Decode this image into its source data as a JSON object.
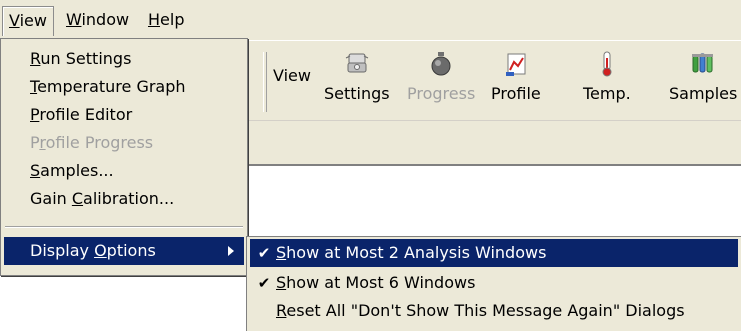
{
  "menubar": {
    "view": "View",
    "window": "Window",
    "help": "Help"
  },
  "view_menu": {
    "items": [
      {
        "label": "Run Settings",
        "enabled": true
      },
      {
        "label": "Temperature Graph",
        "enabled": true
      },
      {
        "label": "Profile Editor",
        "enabled": true
      },
      {
        "label": "Profile Progress",
        "enabled": false
      },
      {
        "label": "Samples...",
        "enabled": true
      },
      {
        "label": "Gain Calibration...",
        "enabled": true
      }
    ],
    "display_options": "Display Options"
  },
  "display_options_menu": {
    "items": [
      {
        "label": "Show at Most 2 Analysis Windows",
        "checked": true,
        "highlighted": true
      },
      {
        "label": "Show at Most 6 Windows",
        "checked": true,
        "highlighted": false
      },
      {
        "label": "Reset All \"Don't Show This Message Again\" Dialogs",
        "checked": false,
        "highlighted": false
      }
    ],
    "check_glyph": "✔"
  },
  "toolbar": {
    "caption": "View",
    "buttons": [
      {
        "label": "Settings",
        "icon": "settings-icon",
        "enabled": true
      },
      {
        "label": "Progress",
        "icon": "progress-icon",
        "enabled": false
      },
      {
        "label": "Profile",
        "icon": "profile-icon",
        "enabled": true
      },
      {
        "label": "Temp.",
        "icon": "thermometer-icon",
        "enabled": true
      },
      {
        "label": "Samples",
        "icon": "samples-icon",
        "enabled": true
      }
    ]
  },
  "colors": {
    "menu_face": "#ece9d8",
    "highlight": "#0a246a",
    "disabled_text": "#a0a0a0"
  }
}
